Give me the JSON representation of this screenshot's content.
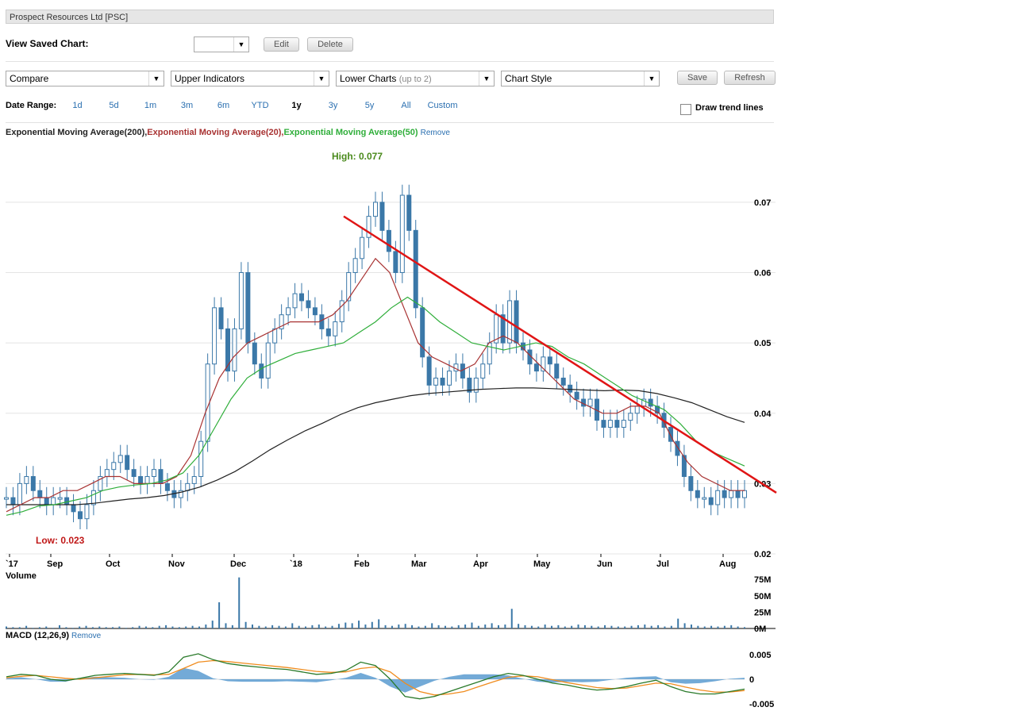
{
  "header": {
    "title": "Prospect Resources Ltd [PSC]"
  },
  "saved_chart": {
    "label": "View Saved Chart:",
    "value": "",
    "edit": "Edit",
    "delete": "Delete"
  },
  "toolbar": {
    "compare": "Compare",
    "upper": "Upper Indicators",
    "lower": "Lower Charts",
    "lower_hint": "(up to 2)",
    "style": "Chart Style",
    "save": "Save",
    "refresh": "Refresh"
  },
  "date_range": {
    "label": "Date Range:",
    "options": [
      "1d",
      "5d",
      "1m",
      "3m",
      "6m",
      "YTD",
      "1y",
      "3y",
      "5y",
      "All",
      "Custom"
    ],
    "selected": "1y"
  },
  "trend": {
    "label": "Draw trend lines",
    "checked": false
  },
  "indicators": {
    "ema200": "Exponential Moving Average(200)",
    "ema20": "Exponential Moving Average(20)",
    "ema50": "Exponential Moving Average(50)",
    "sep": ",",
    "remove": "Remove"
  },
  "colors": {
    "candle": "#3b78a8",
    "ema200": "#222222",
    "ema20": "#a83232",
    "ema50": "#2fae3a",
    "trend": "#e01515",
    "high": "#4a8a1c",
    "low": "#c01818",
    "link": "#2a6fb0",
    "macd_hist": "#5b9bd0",
    "macd": "#2a7a2a",
    "signal": "#f08c1e"
  },
  "chart_data": [
    {
      "type": "candlestick",
      "title": "Prospect Resources Ltd [PSC]",
      "x_ticks": [
        "`17",
        "Sep",
        "Oct",
        "Nov",
        "Dec",
        "`18",
        "Feb",
        "Mar",
        "Apr",
        "May",
        "Jun",
        "Jul",
        "Aug"
      ],
      "y_ticks": [
        "0.07",
        "0.06",
        "0.05",
        "0.04",
        "0.03",
        "0.02"
      ],
      "ylim": [
        0.02,
        0.078
      ],
      "annotations": {
        "high": "High: 0.077",
        "low": "Low: 0.023"
      },
      "close": [
        0.028,
        0.027,
        0.03,
        0.031,
        0.029,
        0.028,
        0.027,
        0.028,
        0.028,
        0.027,
        0.026,
        0.025,
        0.027,
        0.029,
        0.031,
        0.032,
        0.033,
        0.034,
        0.032,
        0.031,
        0.03,
        0.031,
        0.032,
        0.03,
        0.029,
        0.028,
        0.029,
        0.03,
        0.031,
        0.036,
        0.047,
        0.055,
        0.052,
        0.046,
        0.052,
        0.06,
        0.05,
        0.047,
        0.045,
        0.05,
        0.052,
        0.054,
        0.055,
        0.057,
        0.056,
        0.055,
        0.054,
        0.052,
        0.051,
        0.053,
        0.056,
        0.06,
        0.062,
        0.065,
        0.068,
        0.07,
        0.066,
        0.063,
        0.06,
        0.071,
        0.066,
        0.055,
        0.048,
        0.044,
        0.045,
        0.044,
        0.046,
        0.047,
        0.045,
        0.043,
        0.045,
        0.047,
        0.05,
        0.054,
        0.05,
        0.056,
        0.05,
        0.049,
        0.047,
        0.046,
        0.048,
        0.047,
        0.045,
        0.044,
        0.043,
        0.042,
        0.041,
        0.042,
        0.039,
        0.038,
        0.039,
        0.038,
        0.039,
        0.04,
        0.041,
        0.042,
        0.041,
        0.04,
        0.038,
        0.036,
        0.034,
        0.031,
        0.029,
        0.028,
        0.028,
        0.027,
        0.029,
        0.028,
        0.029,
        0.028,
        0.029
      ],
      "series": [
        {
          "name": "Exponential Moving Average(200)",
          "values": [
            0.027,
            0.027,
            0.027,
            0.027,
            0.027,
            0.0272,
            0.0275,
            0.0278,
            0.028,
            0.0283,
            0.0288,
            0.0295,
            0.0305,
            0.0317,
            0.0332,
            0.0348,
            0.0362,
            0.0375,
            0.0386,
            0.0398,
            0.0408,
            0.0415,
            0.042,
            0.0425,
            0.0428,
            0.043,
            0.0432,
            0.0434,
            0.0435,
            0.0436,
            0.0436,
            0.0435,
            0.0434,
            0.0433,
            0.0432,
            0.0433,
            0.0432,
            0.0428,
            0.0422,
            0.0415,
            0.0405,
            0.0395,
            0.0387
          ]
        },
        {
          "name": "Exponential Moving Average(20)",
          "values": [
            0.026,
            0.027,
            0.028,
            0.028,
            0.029,
            0.029,
            0.03,
            0.031,
            0.031,
            0.03,
            0.03,
            0.03,
            0.031,
            0.034,
            0.04,
            0.045,
            0.048,
            0.05,
            0.051,
            0.052,
            0.053,
            0.053,
            0.053,
            0.054,
            0.056,
            0.059,
            0.062,
            0.06,
            0.055,
            0.05,
            0.048,
            0.047,
            0.046,
            0.047,
            0.05,
            0.051,
            0.05,
            0.048,
            0.046,
            0.044,
            0.042,
            0.041,
            0.04,
            0.04,
            0.041,
            0.041,
            0.04,
            0.036,
            0.033,
            0.031,
            0.03,
            0.029,
            0.029
          ]
        },
        {
          "name": "Exponential Moving Average(50)",
          "values": [
            0.0255,
            0.026,
            0.0268,
            0.027,
            0.0275,
            0.028,
            0.029,
            0.0295,
            0.0298,
            0.03,
            0.0305,
            0.0315,
            0.034,
            0.038,
            0.042,
            0.045,
            0.0465,
            0.0475,
            0.0485,
            0.049,
            0.0495,
            0.05,
            0.0515,
            0.053,
            0.055,
            0.0565,
            0.055,
            0.053,
            0.0515,
            0.05,
            0.0495,
            0.049,
            0.0495,
            0.05,
            0.0495,
            0.048,
            0.047,
            0.0455,
            0.044,
            0.0425,
            0.0415,
            0.0405,
            0.0385,
            0.036,
            0.0345,
            0.0335,
            0.0325
          ]
        }
      ],
      "trend_line": {
        "from": [
          "Jan",
          "0.068"
        ],
        "to": [
          "Aug",
          "0.029"
        ]
      }
    },
    {
      "type": "bar",
      "title": "Volume",
      "y_ticks": [
        "75M",
        "50M",
        "25M",
        "0M"
      ],
      "ylim": [
        0,
        80
      ],
      "values": [
        3,
        2,
        2,
        4,
        1,
        2,
        3,
        1,
        5,
        2,
        1,
        3,
        4,
        2,
        3,
        2,
        2,
        3,
        1,
        2,
        4,
        3,
        2,
        4,
        5,
        3,
        2,
        3,
        4,
        3,
        6,
        12,
        40,
        8,
        5,
        78,
        10,
        6,
        4,
        3,
        5,
        4,
        3,
        8,
        4,
        3,
        5,
        6,
        3,
        4,
        7,
        9,
        8,
        12,
        6,
        10,
        14,
        5,
        4,
        6,
        7,
        5,
        3,
        4,
        8,
        5,
        4,
        3,
        5,
        6,
        9,
        4,
        6,
        8,
        5,
        6,
        30,
        7,
        5,
        4,
        3,
        6,
        4,
        5,
        3,
        4,
        6,
        5,
        4,
        3,
        5,
        4,
        3,
        3,
        4,
        5,
        6,
        4,
        5,
        3,
        4,
        15,
        8,
        6,
        4,
        3,
        4,
        3,
        4,
        5,
        3,
        2
      ]
    },
    {
      "type": "line",
      "title": "MACD (12,26,9)",
      "y_ticks": [
        "0.005",
        "0",
        "-0.005"
      ],
      "ylim": [
        -0.0055,
        0.0055
      ],
      "series": [
        {
          "name": "MACD",
          "values": [
            0.0005,
            0.001,
            0.0008,
            0.0,
            -0.0003,
            0.0002,
            0.0008,
            0.001,
            0.0012,
            0.001,
            0.0008,
            0.0015,
            0.0045,
            0.0052,
            0.004,
            0.0032,
            0.0028,
            0.0025,
            0.0022,
            0.002,
            0.0015,
            0.001,
            0.0012,
            0.0018,
            0.0035,
            0.0028,
            0.0,
            -0.0035,
            -0.004,
            -0.0035,
            -0.0025,
            -0.0015,
            -0.0005,
            0.0005,
            0.0012,
            0.0008,
            0.0,
            -0.0008,
            -0.0012,
            -0.0018,
            -0.0022,
            -0.002,
            -0.0015,
            -0.0008,
            -0.0002,
            -0.0015,
            -0.0025,
            -0.003,
            -0.003,
            -0.0025,
            -0.002
          ]
        },
        {
          "name": "Signal",
          "values": [
            0.0003,
            0.0006,
            0.0008,
            0.0005,
            0.0002,
            0.0,
            0.0003,
            0.0006,
            0.0009,
            0.001,
            0.0009,
            0.001,
            0.0022,
            0.0035,
            0.0038,
            0.0036,
            0.0033,
            0.003,
            0.0027,
            0.0024,
            0.002,
            0.0016,
            0.0014,
            0.0015,
            0.0022,
            0.0025,
            0.0015,
            -0.0008,
            -0.0025,
            -0.0032,
            -0.003,
            -0.0025,
            -0.0015,
            -0.0005,
            0.0004,
            0.0007,
            0.0005,
            -0.0001,
            -0.0007,
            -0.0012,
            -0.0017,
            -0.0019,
            -0.0018,
            -0.0013,
            -0.0008,
            -0.0009,
            -0.0016,
            -0.0022,
            -0.0026,
            -0.0026,
            -0.0023
          ]
        }
      ]
    }
  ]
}
